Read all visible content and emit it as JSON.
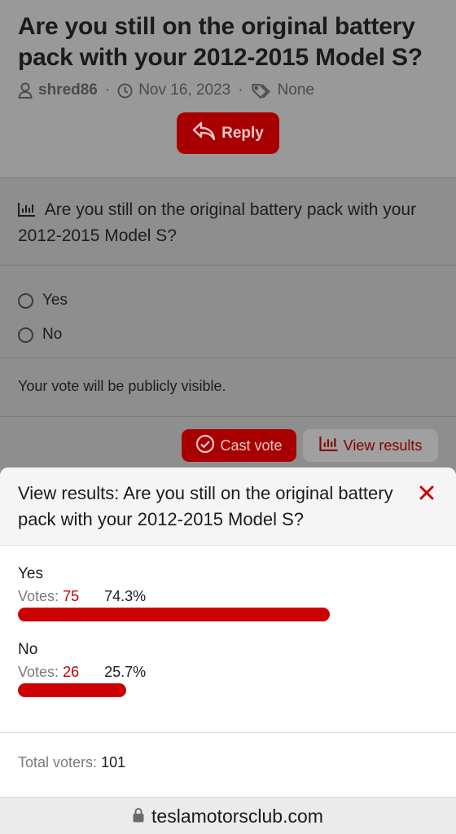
{
  "thread": {
    "title": "Are you still on the original battery pack with your 2012-2015 Model S?",
    "author": "shred86",
    "date": "Nov 16, 2023",
    "tags": "None",
    "reply_label": "Reply",
    "separator": "·"
  },
  "poll": {
    "question": "Are you still on the original battery pack with your 2012-2015 Model S?",
    "options": [
      "Yes",
      "No"
    ],
    "public_note": "Your vote will be publicly visible.",
    "cast_vote_label": "Cast vote",
    "view_results_label": "View results"
  },
  "results_modal": {
    "title": "View results: Are you still on the original battery pack with your 2012-2015 Model S?",
    "votes_prefix": "Votes:",
    "results": [
      {
        "label": "Yes",
        "votes": "75",
        "percent": "74.3%",
        "fraction": 0.743
      },
      {
        "label": "No",
        "votes": "26",
        "percent": "25.7%",
        "fraction": 0.257
      }
    ],
    "total_label": "Total voters:",
    "total_value": "101"
  },
  "browser": {
    "domain": "teslamotorsclub.com"
  },
  "colors": {
    "accent": "#cc0000",
    "accent_dimmed": "#a80000"
  },
  "icons": [
    "user-icon",
    "clock-icon",
    "tag-icon",
    "reply-icon",
    "poll-chart-icon",
    "check-circle-icon",
    "close-icon",
    "lock-icon"
  ]
}
